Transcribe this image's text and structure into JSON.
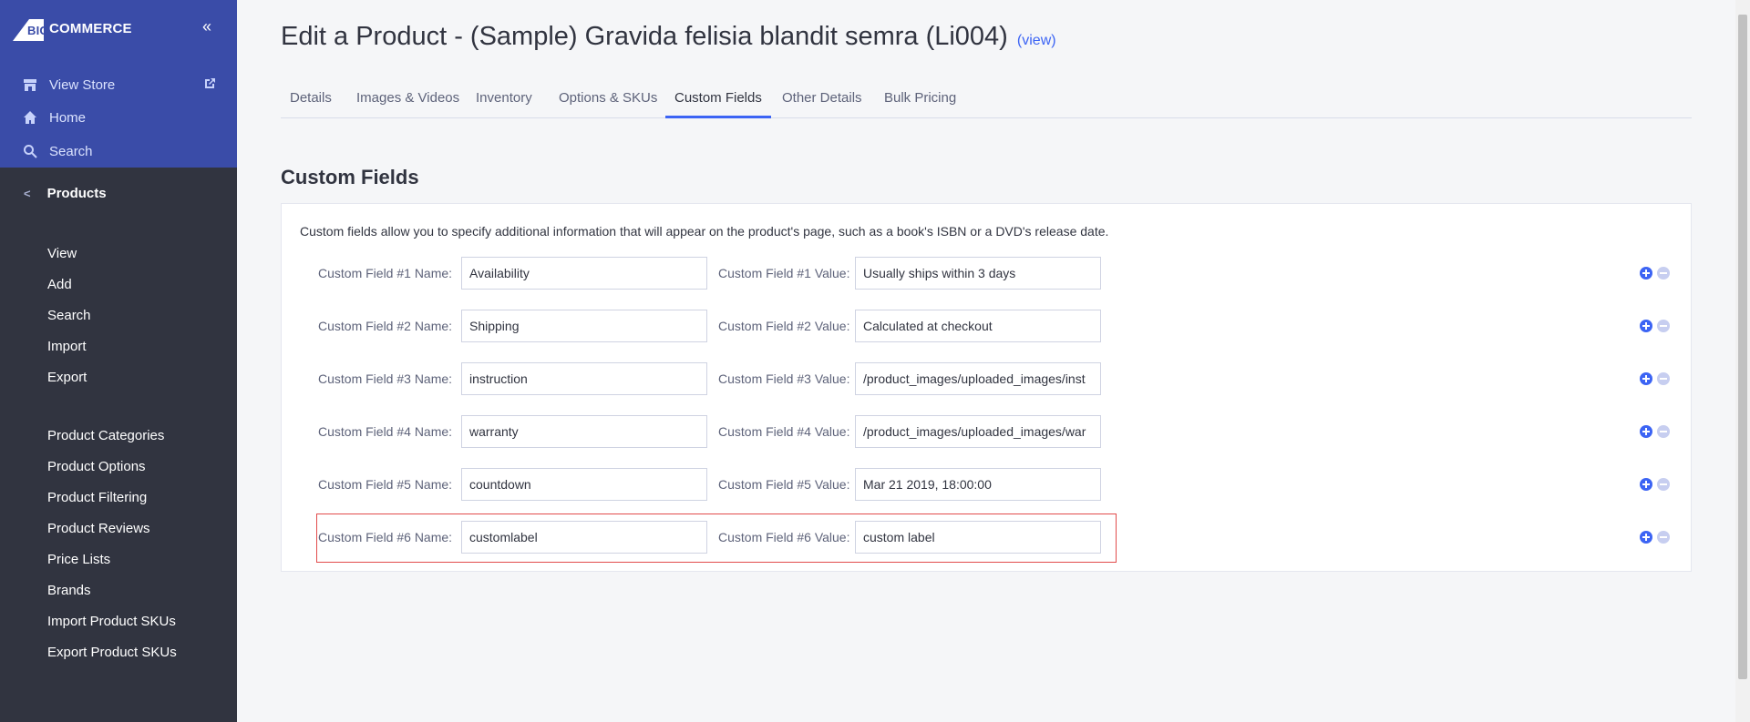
{
  "app": {
    "brand": "COMMERCE",
    "brand_prefix": "BIG"
  },
  "sidebar": {
    "top_links": [
      {
        "label": "View Store",
        "icon": "store-icon"
      },
      {
        "label": "Home",
        "icon": "home-icon"
      },
      {
        "label": "Search",
        "icon": "search-icon"
      }
    ],
    "section": "Products",
    "items": [
      "View",
      "Add",
      "Search",
      "Import",
      "Export"
    ],
    "items2": [
      "Product Categories",
      "Product Options",
      "Product Filtering",
      "Product Reviews",
      "Price Lists",
      "Brands",
      "Import Product SKUs",
      "Export Product SKUs"
    ]
  },
  "page": {
    "title": "Edit a Product - (Sample) Gravida felisia blandit semra (Li004)",
    "view_link": "(view)"
  },
  "tabs": [
    "Details",
    "Images & Videos",
    "Inventory",
    "Options & SKUs",
    "Custom Fields",
    "Other Details",
    "Bulk Pricing"
  ],
  "active_tab": "Custom Fields",
  "custom_fields": {
    "title": "Custom Fields",
    "description": "Custom fields allow you to specify additional information that will appear on the product's page, such as a book's ISBN or a DVD's release date.",
    "rows": [
      {
        "name_label": "Custom Field #1 Name:",
        "name": "Availability",
        "value_label": "Custom Field #1 Value:",
        "value": "Usually ships within 3 days"
      },
      {
        "name_label": "Custom Field #2 Name:",
        "name": "Shipping",
        "value_label": "Custom Field #2 Value:",
        "value": "Calculated at checkout"
      },
      {
        "name_label": "Custom Field #3 Name:",
        "name": "instruction",
        "value_label": "Custom Field #3 Value:",
        "value": "/product_images/uploaded_images/inst"
      },
      {
        "name_label": "Custom Field #4 Name:",
        "name": "warranty",
        "value_label": "Custom Field #4 Value:",
        "value": "/product_images/uploaded_images/war"
      },
      {
        "name_label": "Custom Field #5 Name:",
        "name": "countdown",
        "value_label": "Custom Field #5 Value:",
        "value": "Mar 21 2019, 18:00:00"
      },
      {
        "name_label": "Custom Field #6 Name:",
        "name": "customlabel",
        "value_label": "Custom Field #6 Value:",
        "value": "custom label"
      }
    ]
  },
  "colors": {
    "accent": "#3c64f4",
    "sidebar_top": "#3a4ca8",
    "sidebar": "#313440",
    "highlight": "#e24b4b"
  }
}
